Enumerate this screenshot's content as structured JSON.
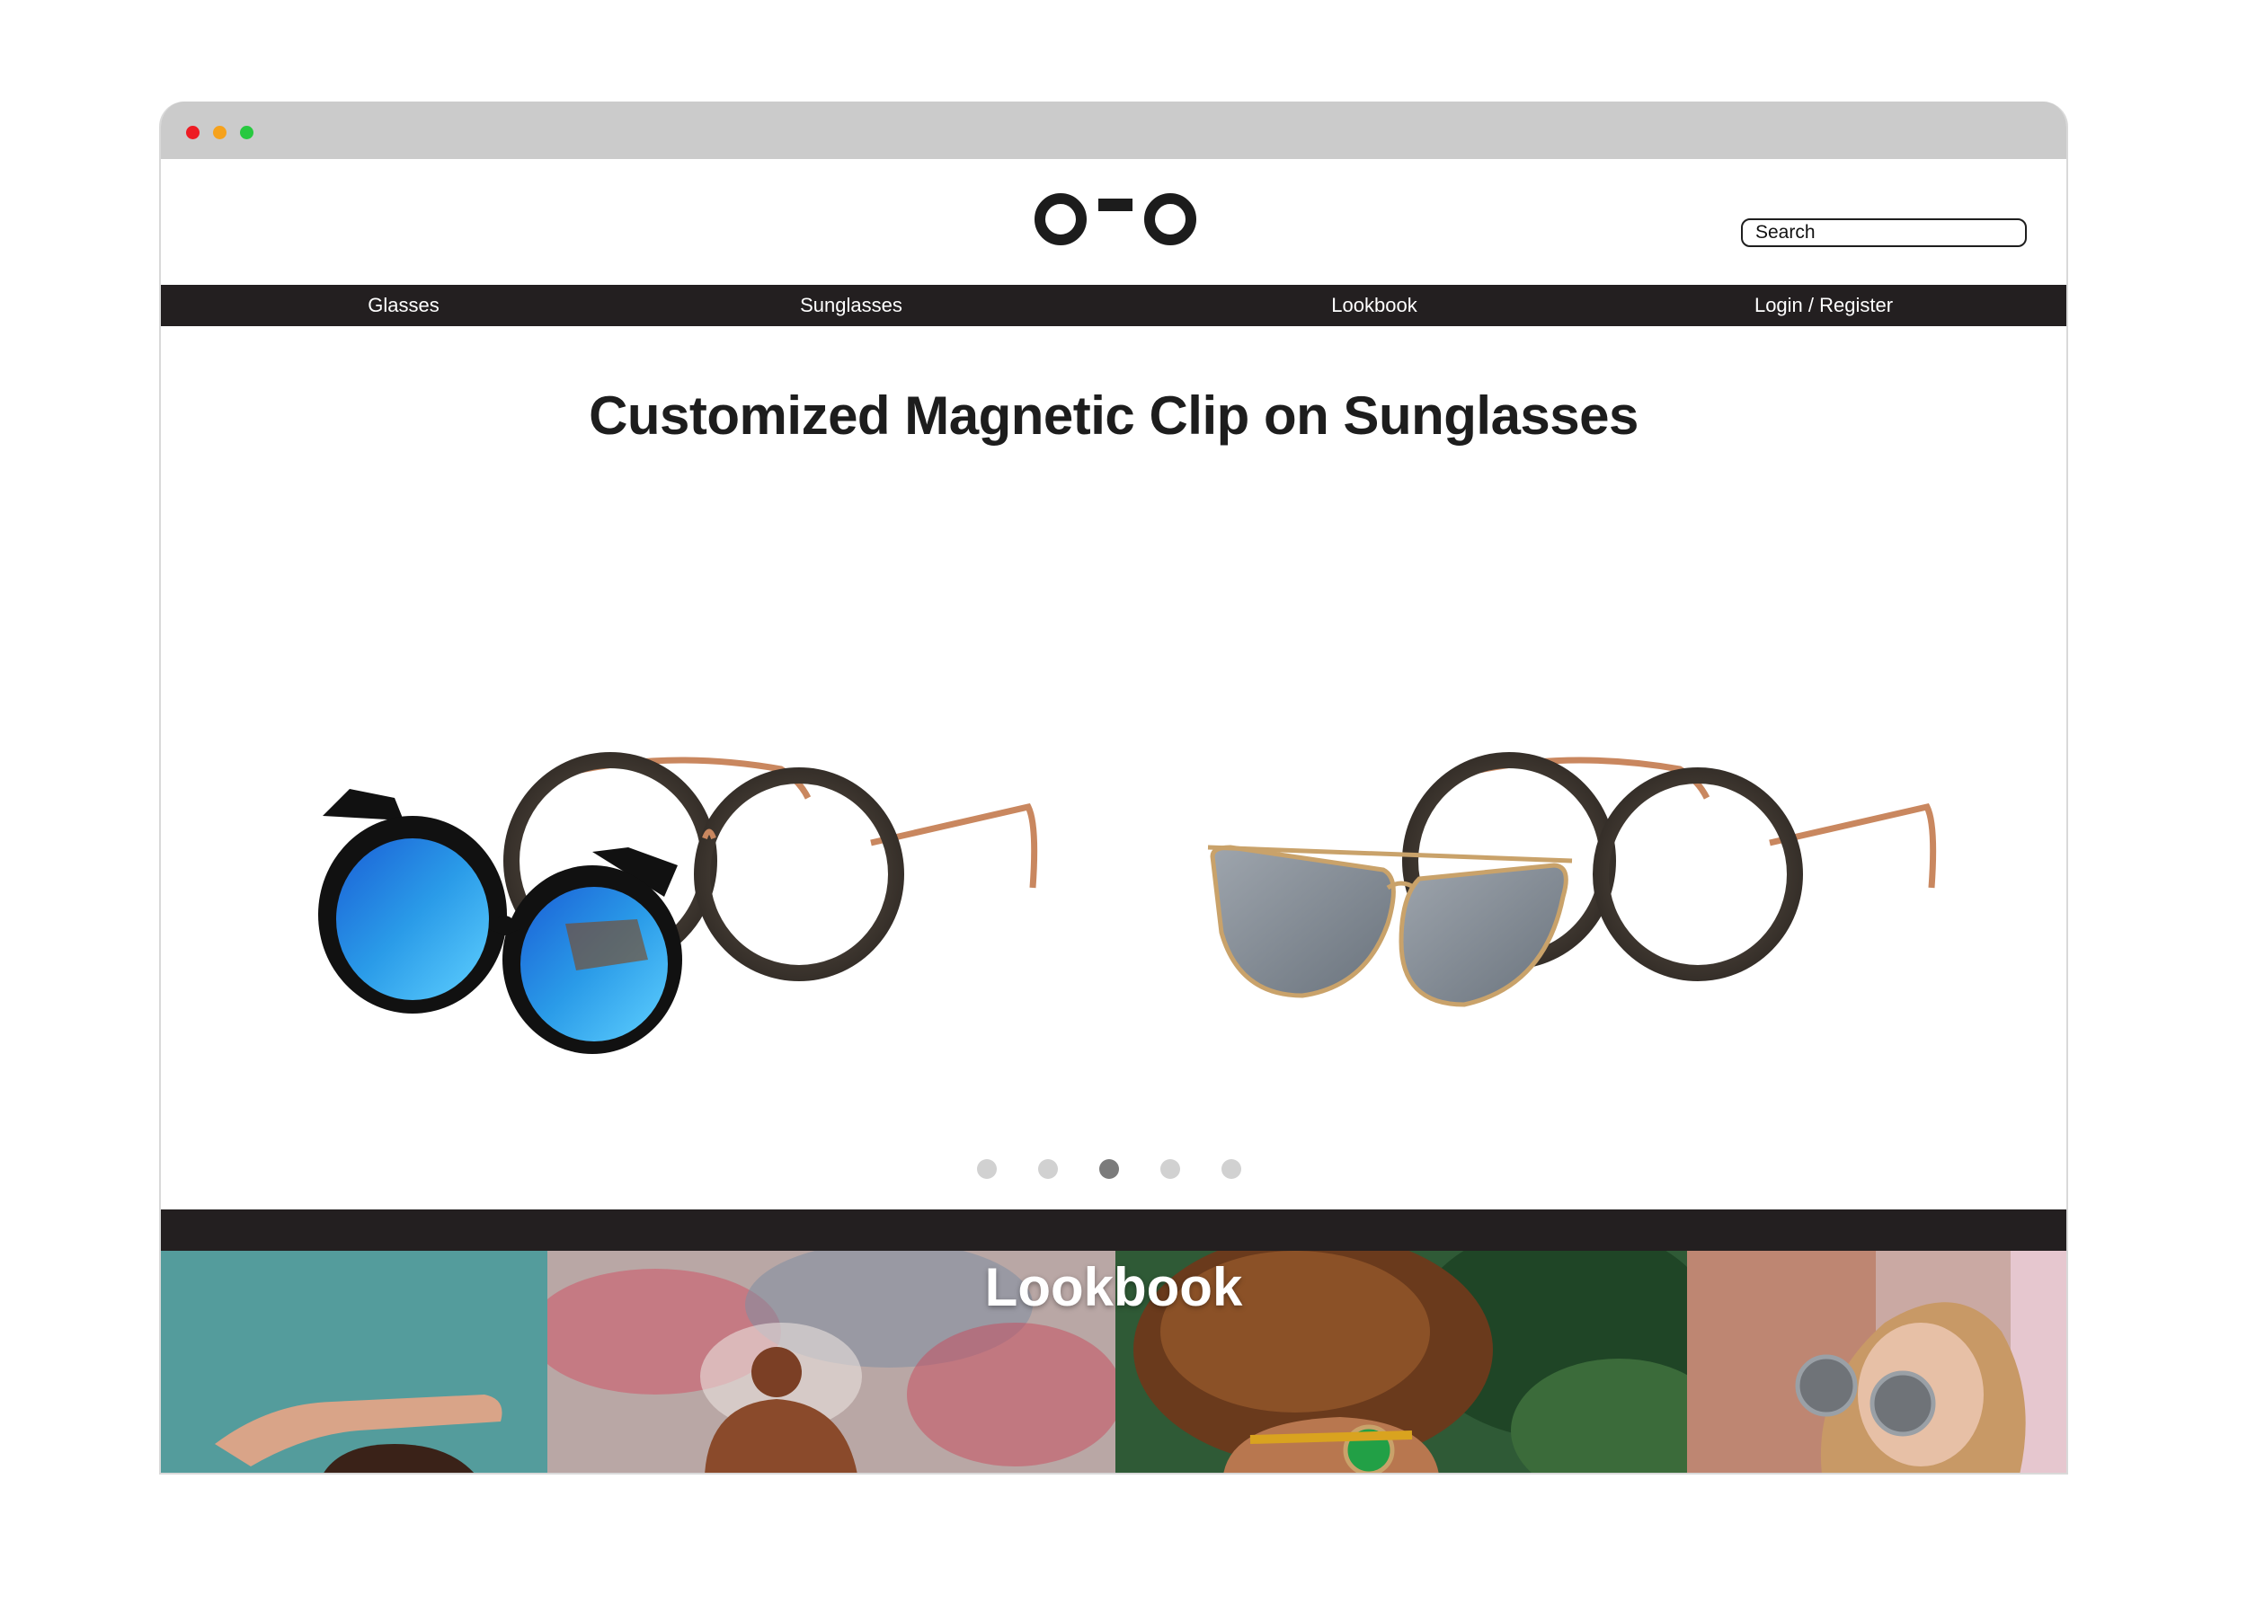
{
  "window": {
    "controls": [
      "close-dot",
      "minimize-dot",
      "maximize-dot"
    ]
  },
  "header": {
    "logo_icon": "oo-glasses-logo",
    "search": {
      "value": "Search"
    }
  },
  "nav": {
    "items": [
      {
        "label": "Glasses"
      },
      {
        "label": "Sunglasses"
      },
      {
        "label": "Lookbook"
      },
      {
        "label": "Login / Register"
      }
    ]
  },
  "hero": {
    "title": "Customized Magnetic Clip on Sunglasses",
    "products": [
      {
        "icon": "cat-eye-blue-mirror-clip-glasses-image"
      },
      {
        "icon": "silver-aviator-clip-glasses-image"
      }
    ]
  },
  "carousel": {
    "total": 5,
    "active_index": 2
  },
  "lookbook": {
    "title": "Lookbook",
    "photos": [
      {
        "icon": "model-photo-arm-raised"
      },
      {
        "icon": "model-photo-hair-bun"
      },
      {
        "icon": "model-photo-curly-hair-green-glasses"
      },
      {
        "icon": "model-photo-round-sunglasses"
      }
    ]
  },
  "colors": {
    "nav_bg": "#231f20",
    "titlebar": "#cbcbcb",
    "dot_active": "#7b7b7b",
    "dot_inactive": "#d1d1d1"
  }
}
